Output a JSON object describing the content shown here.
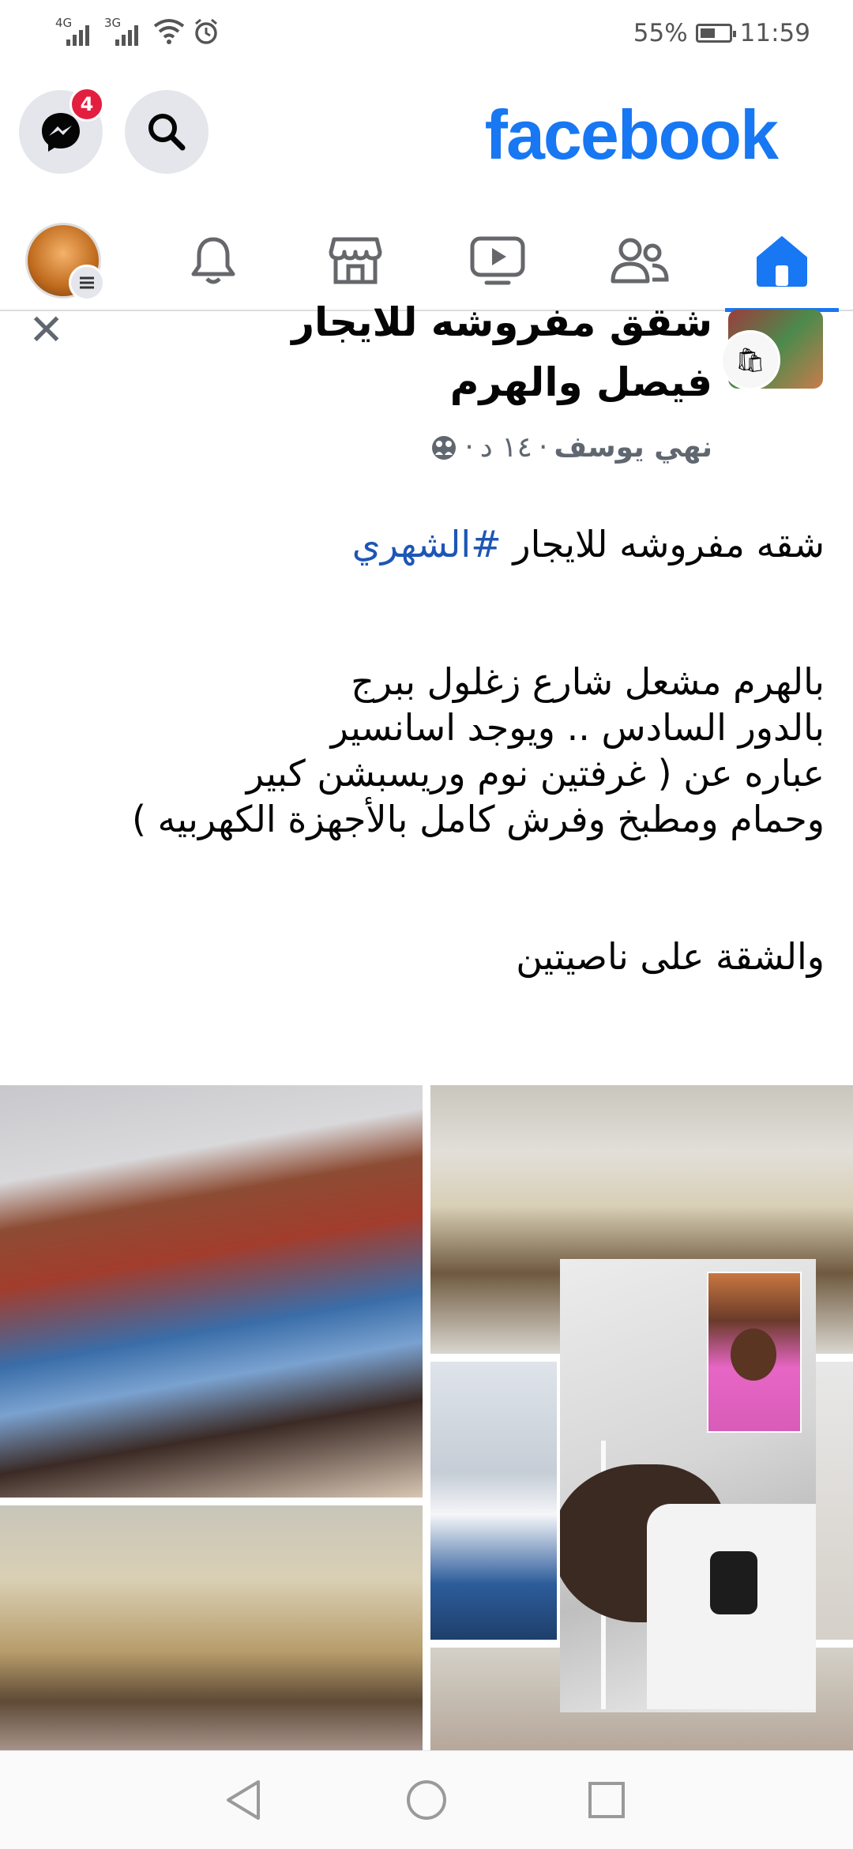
{
  "status_bar": {
    "signal1_label": "4G",
    "signal2_label": "3G",
    "battery_percent": "55%",
    "battery_level": 0.55,
    "time": "11:59"
  },
  "header": {
    "logo": "facebook",
    "messenger_badge": "4"
  },
  "tabs": [
    {
      "name": "home",
      "active": true
    },
    {
      "name": "friends",
      "active": false
    },
    {
      "name": "watch",
      "active": false
    },
    {
      "name": "marketplace",
      "active": false
    },
    {
      "name": "notifications",
      "active": false
    },
    {
      "name": "menu",
      "active": false
    }
  ],
  "post": {
    "group_title": "شقق مفروشه للايجار فيصل والهرم",
    "author": "نهي يوسف",
    "time": "١٤ د",
    "body": {
      "line1_text": "شقه مفروشه للايجار",
      "line1_hashtag": "#الشهري",
      "para2": [
        "بالهرم مشعل شارع زغلول ببرج",
        "بالدور السادس .. ويوجد اسانسير",
        "عباره عن (  غرفتين نوم وريسبشن كبير",
        "وحمام ومطبخ وفرش كامل بالأجهزة الكهربيه )"
      ],
      "para3": "والشقة على ناصيتين"
    }
  },
  "colors": {
    "brand": "#1877f2",
    "hashtag": "#1d56b5",
    "badge": "#e41e3f"
  }
}
